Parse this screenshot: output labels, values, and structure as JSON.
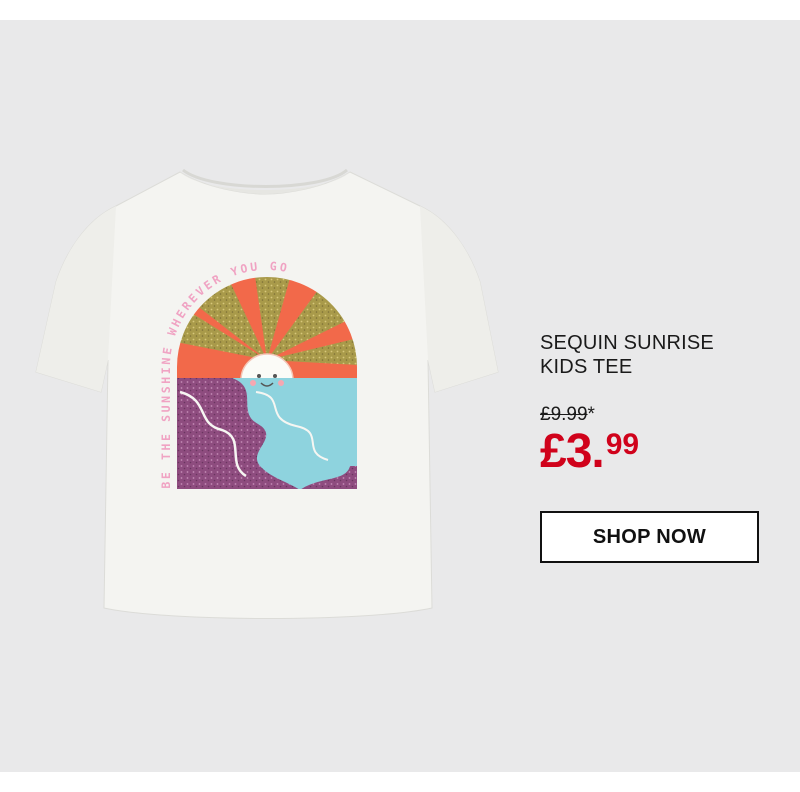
{
  "product": {
    "title_line1": "SEQUIN SUNRISE",
    "title_line2": "KIDS TEE",
    "was_price": "£9.99",
    "was_price_marker": "*",
    "now_price_main": "£3.",
    "now_price_pence": "99",
    "cta_label": "SHOP NOW",
    "print_slogan": "BE THE SUNSHINE WHEREVER YOU GO"
  },
  "colors": {
    "background": "#e9e9ea",
    "price_red": "#d0021b",
    "text": "#1a1a1a",
    "shirt": "#f4f4f1",
    "sun_orange": "#f2694a",
    "glitter_gold": "#a99a4a",
    "sea_blue": "#8ed3de",
    "glitter_purple": "#8e4c7f",
    "slogan_pink": "#f0a3c3"
  },
  "icons": {
    "product_image": "kids-tshirt-sunrise-print"
  }
}
